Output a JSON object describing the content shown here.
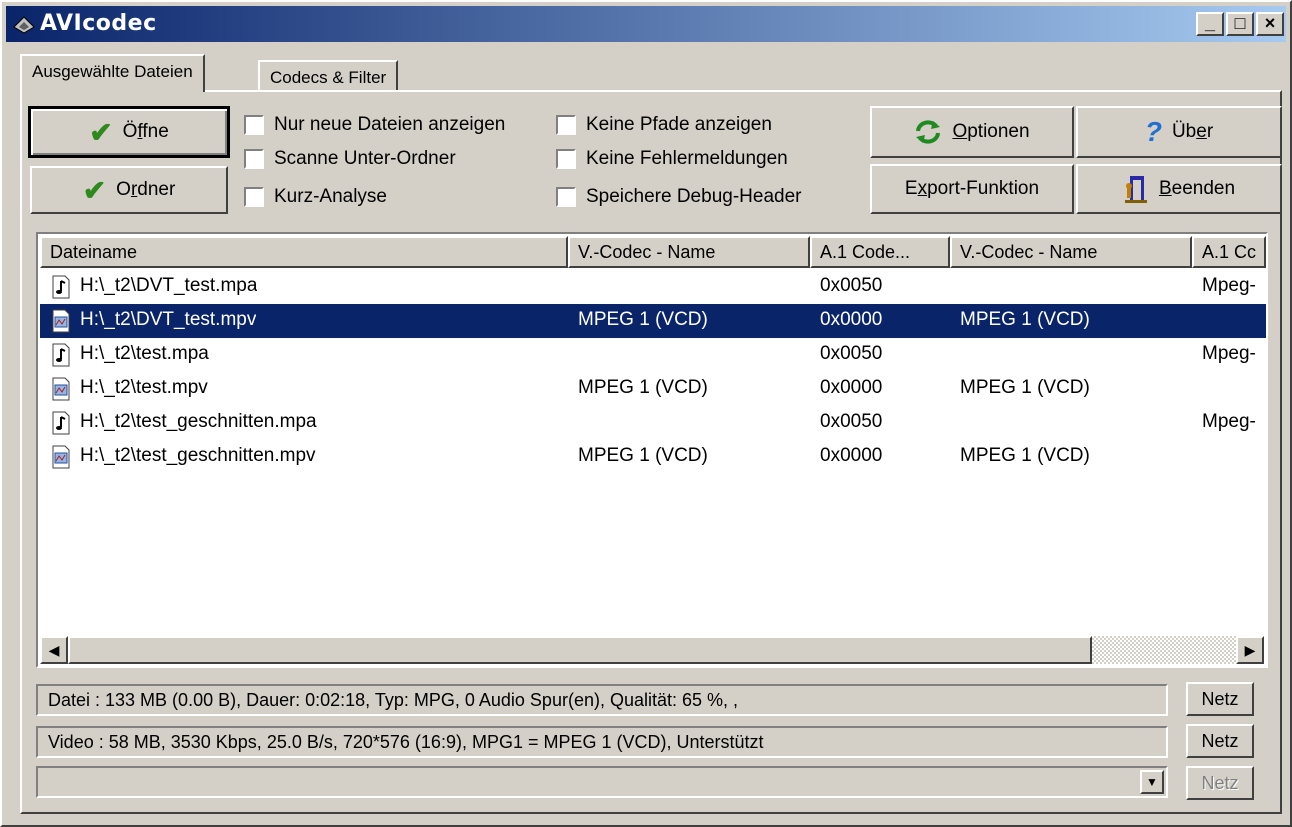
{
  "window": {
    "title": "AVIcodec",
    "min": "_",
    "max": "□",
    "close": "×"
  },
  "tabs": [
    {
      "label": "Ausgewählte Dateien"
    },
    {
      "label": "Codecs & Filter"
    }
  ],
  "buttons": {
    "open": {
      "pre": "Ö",
      "u": "f",
      "post": "fne"
    },
    "folder": {
      "pre": "O",
      "u": "r",
      "post": "dner"
    },
    "options": {
      "pre": "",
      "u": "O",
      "post": "ptionen"
    },
    "about": {
      "pre": "Üb",
      "u": "e",
      "post": "r"
    },
    "export": {
      "pre": "E",
      "u": "x",
      "post": "port-Funktion"
    },
    "quit": {
      "pre": "",
      "u": "B",
      "post": "eenden"
    }
  },
  "checkboxes": [
    "Nur neue Dateien anzeigen",
    "Scanne Unter-Ordner",
    "Kurz-Analyse",
    "Keine Pfade anzeigen",
    "Keine Fehlermeldungen",
    "Speichere Debug-Header"
  ],
  "columns": [
    "Dateiname",
    "V.-Codec - Name",
    "A.1 Code...",
    "V.-Codec - Name",
    "A.1 Cc"
  ],
  "rows": [
    {
      "file": "H:\\_t2\\DVT_test.mpa",
      "vcodec": "",
      "a1": "0x0050",
      "vcodec2": "",
      "a1b": "Mpeg-",
      "icon": "audio-file-icon"
    },
    {
      "file": "H:\\_t2\\DVT_test.mpv",
      "vcodec": "MPEG 1 (VCD)",
      "a1": "0x0000",
      "vcodec2": "MPEG 1 (VCD)",
      "a1b": "",
      "icon": "video-file-icon"
    },
    {
      "file": "H:\\_t2\\test.mpa",
      "vcodec": "",
      "a1": "0x0050",
      "vcodec2": "",
      "a1b": "Mpeg-",
      "icon": "audio-file-icon"
    },
    {
      "file": "H:\\_t2\\test.mpv",
      "vcodec": "MPEG 1 (VCD)",
      "a1": "0x0000",
      "vcodec2": "MPEG 1 (VCD)",
      "a1b": "",
      "icon": "video-file-icon"
    },
    {
      "file": "H:\\_t2\\test_geschnitten.mpa",
      "vcodec": "",
      "a1": "0x0050",
      "vcodec2": "",
      "a1b": "Mpeg-",
      "icon": "audio-file-icon"
    },
    {
      "file": "H:\\_t2\\test_geschnitten.mpv",
      "vcodec": "MPEG 1 (VCD)",
      "a1": "0x0000",
      "vcodec2": "MPEG 1 (VCD)",
      "a1b": "",
      "icon": "video-file-icon"
    }
  ],
  "selected_row": 1,
  "info": {
    "file_line": "Datei :  133 MB (0.00 B),  Dauer: 0:02:18,  Typ: MPG,  0 Audio Spur(en),  Qualität: 65 %, ,",
    "video_line": "Video :  58 MB,  3530 Kbps,  25.0 B/s,  720*576 (16:9),  MPG1 = MPEG 1 (VCD),    Unterstützt",
    "audio_line": ""
  },
  "netz_label": "Netz",
  "colors": {
    "selection": "#0a246a",
    "title_start": "#0a246a",
    "title_end": "#a6caf0",
    "check": "#2e8a1c"
  }
}
